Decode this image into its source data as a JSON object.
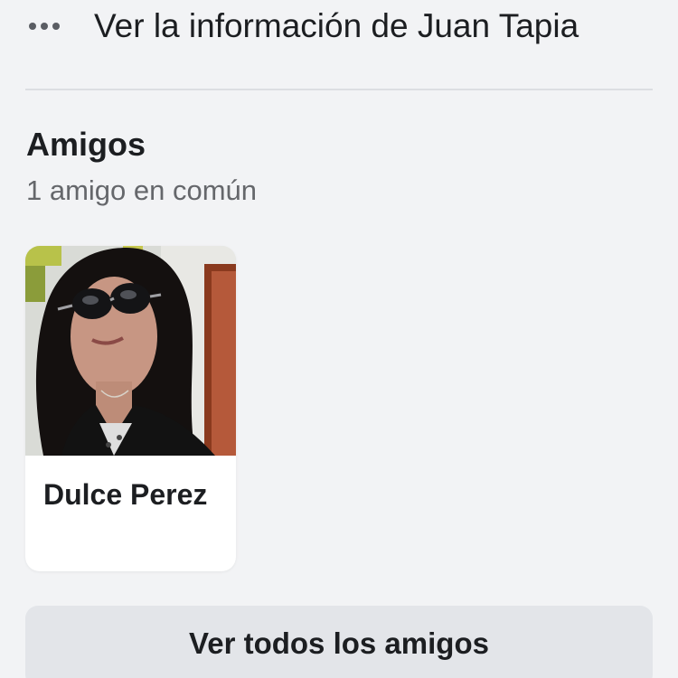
{
  "profile_info": {
    "view_info_label": "Ver la información de Juan Tapia",
    "more_icon": "more-dots-icon"
  },
  "friends_section": {
    "title": "Amigos",
    "subtitle": "1 amigo en común",
    "friends": [
      {
        "name": "Dulce Perez",
        "photo": "profile-photo"
      }
    ],
    "see_all_label": "Ver todos los amigos"
  },
  "colors": {
    "page_background": "#f2f3f5",
    "primary_text": "#1c1e21",
    "secondary_text": "#65676b",
    "card_background": "#ffffff",
    "button_background": "#e3e5e9",
    "divider": "#dcdee2"
  }
}
